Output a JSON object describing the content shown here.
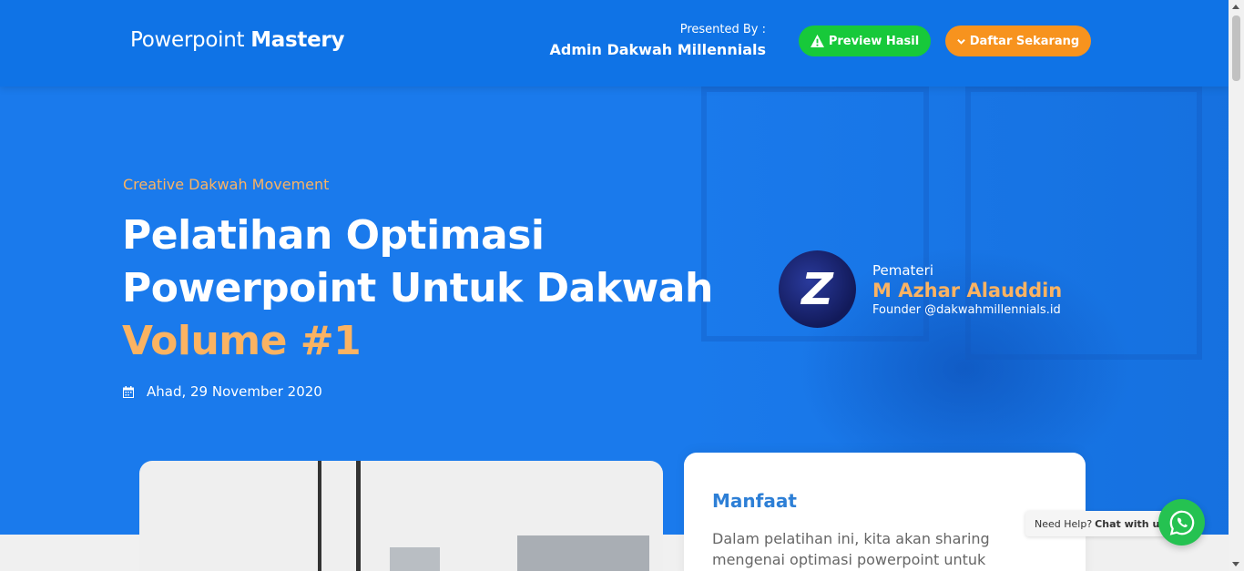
{
  "header": {
    "brand_light": "Powerpoint",
    "brand_bold": "Mastery",
    "presented_label": "Presented By :",
    "presenter": "Admin Dakwah Millennials",
    "preview_button": "Preview Hasil",
    "register_button": "Daftar Sekarang",
    "preview_icon": "warning-icon",
    "register_icon": "chevron-down-icon"
  },
  "hero": {
    "tagline": "Creative Dakwah Movement",
    "title_line1": "Pelatihan Optimasi",
    "title_line2": "Powerpoint Untuk Dakwah",
    "title_volume": "Volume #1",
    "date": "Ahad, 29 November 2020",
    "date_icon": "calendar-icon"
  },
  "speaker": {
    "avatar_letter": "Z",
    "role": "Pemateri",
    "name": "M Azhar Alauddin",
    "desc": "Founder @dakwahmillennials.id"
  },
  "benefit": {
    "title": "Manfaat",
    "text": "Dalam pelatihan ini, kita akan sharing mengenai optimasi powerpoint untuk"
  },
  "chat": {
    "help": "Need Help?",
    "cta": "Chat with us",
    "icon": "whatsapp-icon"
  },
  "colors": {
    "header_bg": "#0f73e6",
    "hero_bg": "#1b7bec",
    "accent_orange": "#fbb362",
    "preview_green": "#17c93a",
    "register_orange": "#f7931e",
    "whatsapp_green": "#25c251"
  }
}
